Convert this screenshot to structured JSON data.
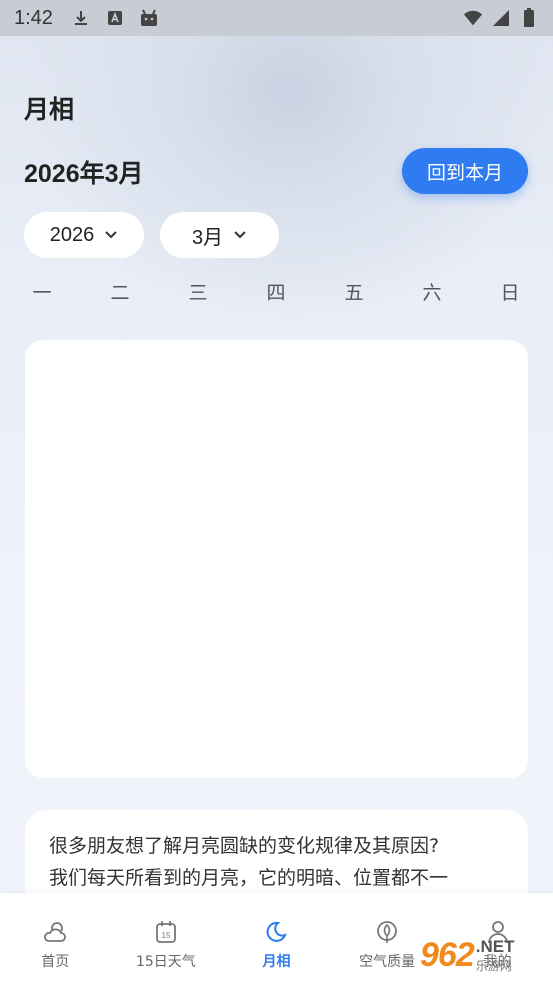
{
  "status_bar": {
    "time": "1:42",
    "icons": [
      "download-icon",
      "a-box-icon",
      "android-icon",
      "wifi-icon",
      "signal-icon",
      "battery-icon"
    ]
  },
  "page": {
    "title": "月相",
    "month_label": "2026年3月",
    "back_button": "回到本月"
  },
  "selectors": {
    "year": "2026",
    "month": "3月"
  },
  "weekdays": [
    "一",
    "二",
    "三",
    "四",
    "五",
    "六",
    "日"
  ],
  "info": {
    "line1": "很多朋友想了解月亮圆缺的变化规律及其原因?",
    "line2": "我们每天所看到的月亮，它的明暗、位置都不一"
  },
  "bottom_nav": {
    "items": [
      {
        "label": "首页",
        "icon": "weather-cloud-sun-icon"
      },
      {
        "label": "15日天气",
        "icon": "calendar-15-icon"
      },
      {
        "label": "月相",
        "icon": "moon-icon",
        "active": true
      },
      {
        "label": "空气质量",
        "icon": "leaf-icon"
      },
      {
        "label": "我的",
        "icon": "person-icon"
      }
    ]
  },
  "watermark": {
    "logo": "962",
    "suffix": ".NET",
    "cn": "乐游网"
  },
  "colors": {
    "accent": "#2f7bf1",
    "background": "#eef2fa",
    "card": "#ffffff"
  }
}
